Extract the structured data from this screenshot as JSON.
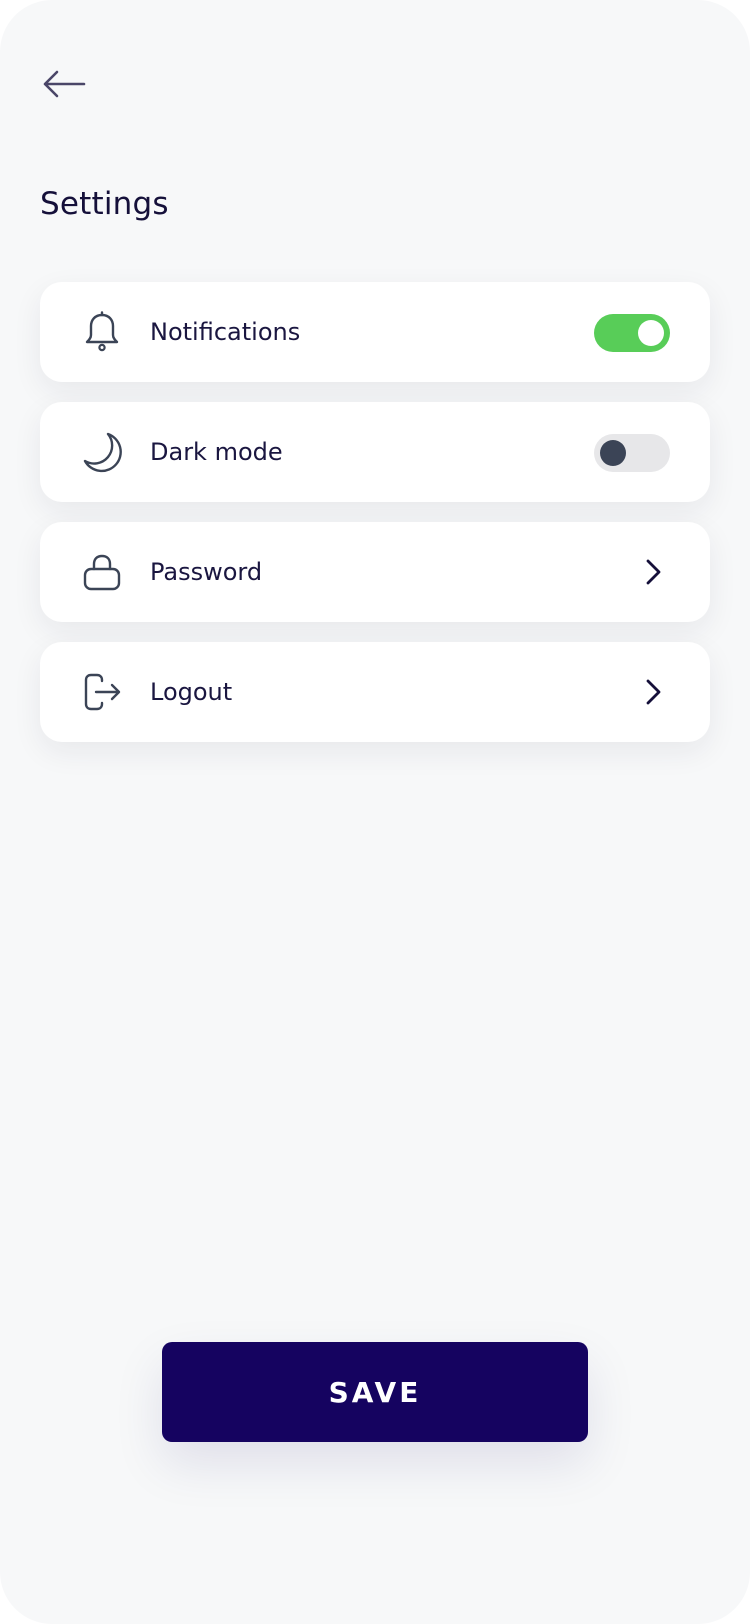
{
  "header": {
    "back_icon": "arrow-left-icon",
    "title": "Settings"
  },
  "settings": [
    {
      "label": "Notifications",
      "icon": "bell-icon",
      "control": "toggle",
      "enabled": true
    },
    {
      "label": "Dark mode",
      "icon": "moon-icon",
      "control": "toggle",
      "enabled": false
    },
    {
      "label": "Password",
      "icon": "lock-icon",
      "control": "chevron"
    },
    {
      "label": "Logout",
      "icon": "logout-icon",
      "control": "chevron"
    }
  ],
  "footer": {
    "save_label": "SAVE"
  },
  "colors": {
    "background": "#f7f8f9",
    "card": "#ffffff",
    "text": "#1a1640",
    "toggle_on": "#58cd58",
    "toggle_off": "#e7e7e9",
    "primary": "#150360"
  }
}
